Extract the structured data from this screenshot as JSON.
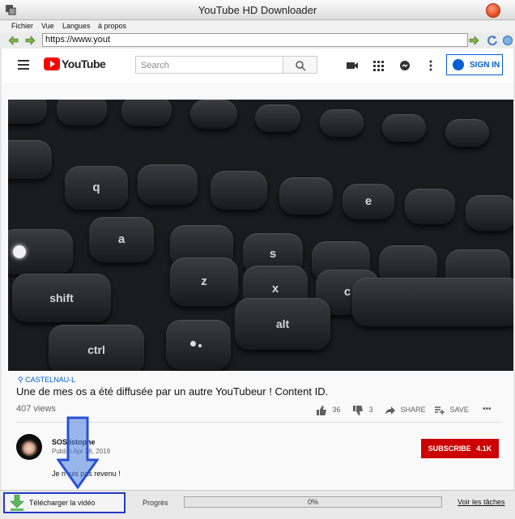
{
  "window": {
    "title": "YouTube HD Downloader"
  },
  "menu": {
    "items": [
      "Fichier",
      "Vue",
      "Langues",
      "à propos"
    ]
  },
  "address_bar": {
    "url": "https://www.yout"
  },
  "youtube": {
    "logo_text": "YouTube",
    "search_placeholder": "Search",
    "signin_label": "SIGN IN",
    "keys": [
      "shift",
      "z",
      "x",
      "c",
      "alt",
      "ctrl",
      "q",
      "a",
      "s",
      "e"
    ],
    "location": "CASTELNAU-L",
    "video_title": "Une de mes          os a été diffusée par un autre YouTubeur ! Content ID.",
    "views": "407 views",
    "likes": "36",
    "dislikes": "3",
    "share_label": "SHARE",
    "save_label": "SAVE",
    "more_label": "•••",
    "channel_name": "SOS      istophe",
    "published": "Publi       n Apr 26, 2019",
    "subscribe_label": "SUBSCRIBE",
    "subscriber_count": "4.1K",
    "description": "Je n'       uis pas revenu !"
  },
  "bottom": {
    "download_label": "Télécharger la vidéo",
    "progress_label": "Progrès",
    "progress_percent": 0,
    "progress_text": "0%",
    "tasks_link": "Voir les tâches"
  },
  "colors": {
    "youtube_red": "#ff0000",
    "subscribe_red": "#cc0000",
    "link_blue": "#065fd4",
    "arrow_blue": "#2a50d6"
  },
  "icons": [
    "app-icon",
    "close-icon",
    "back-arrow-icon",
    "forward-arrow-icon",
    "go-arrow-icon",
    "refresh-icon",
    "stop-icon",
    "hamburger-icon",
    "search-icon",
    "video-camera-icon",
    "apps-grid-icon",
    "messages-icon",
    "more-vert-icon",
    "account-icon",
    "location-pin-icon",
    "thumbs-up-icon",
    "thumbs-down-icon",
    "share-icon",
    "save-playlist-icon",
    "download-icon",
    "annotation-arrow-icon"
  ]
}
